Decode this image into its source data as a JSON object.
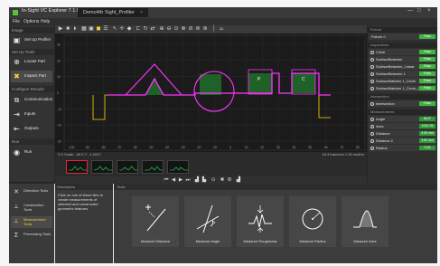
{
  "window": {
    "app_title": "In-Sight VC Explorer 7.1.0",
    "doc_tab": "Demo4th Sight_Profiler",
    "close_tab": "×",
    "controls": [
      "—",
      "□",
      "×"
    ]
  },
  "menu": [
    "File",
    "Options",
    "Help"
  ],
  "left_panel": {
    "sections": [
      {
        "title": "Image",
        "buttons": [
          {
            "label": "Set Up Profiler",
            "icon": "camera-icon"
          }
        ]
      },
      {
        "title": "Set Up Tools",
        "buttons": [
          {
            "label": "Locate Part",
            "icon": "target-icon"
          },
          {
            "label": "Inspect Part",
            "icon": "tools-icon",
            "active": true
          }
        ]
      },
      {
        "title": "Configure Results",
        "buttons": [
          {
            "label": "Communication",
            "icon": "network-icon"
          },
          {
            "label": "Inputs",
            "icon": "input-icon"
          },
          {
            "label": "Outputs",
            "icon": "output-icon"
          }
        ]
      },
      {
        "title": "Run",
        "buttons": [
          {
            "label": "Run",
            "icon": "play-icon"
          }
        ]
      }
    ]
  },
  "status_bar": {
    "left": "X:2 Scale: -90.0   Y: -1.0017",
    "right": "18.3 frames/s   1.29 ms/frm"
  },
  "plot": {
    "x_ticks": [
      "-100",
      "-90",
      "-80",
      "-70",
      "-60",
      "-50",
      "-40",
      "-30",
      "-20",
      "-10",
      "0",
      "10",
      "20",
      "30",
      "40",
      "50",
      "60",
      "70",
      "80"
    ],
    "y_ticks": [
      "30",
      "20",
      "10",
      "0",
      "-10",
      "-20",
      "-30"
    ],
    "region_labels": [
      "P",
      "C"
    ],
    "profile_color": "#ff33ff",
    "circle_color": "#ff33ff",
    "fill_color": "#1f6e2a",
    "baseline_color": "#ffd700"
  },
  "right_panel": {
    "groups": [
      {
        "title": "Fixture",
        "rows": [
          {
            "name": "Fixture 0",
            "status": "Pass"
          }
        ]
      },
      {
        "title": "Inspections",
        "rows": [
          {
            "name": "Circle",
            "status": "Pass"
          },
          {
            "name": "SurfaceBetween",
            "status": "Pass"
          },
          {
            "name": "SurfaceBetween_Linear",
            "status": "Pass"
          },
          {
            "name": "SurfaceBetween 1",
            "status": "Pass"
          },
          {
            "name": "SurfaceMatcher 1_Circle",
            "status": "Pass"
          },
          {
            "name": "SurfaceMatcher 1_Circle_Orient",
            "status": "Pass"
          }
        ]
      },
      {
        "title": "Intersection",
        "rows": [
          {
            "name": "Intersection",
            "status": "Pass"
          }
        ]
      },
      {
        "title": "Measurements",
        "rows": [
          {
            "name": "Angle",
            "status": "80.0°"
          },
          {
            "name": "Area",
            "status": "1012.78"
          },
          {
            "name": "Distance",
            "status": "4.90 mm"
          },
          {
            "name": "Distance 2",
            "status": "3.60 mm"
          },
          {
            "name": "Radius",
            "status": "0.45"
          }
        ]
      }
    ]
  },
  "bottom": {
    "tool_categories": [
      {
        "label": "Detection Tools",
        "icon": "detect-icon"
      },
      {
        "label": "Construction Tools",
        "icon": "construct-icon"
      },
      {
        "label": "Measurement Tools",
        "icon": "measure-icon",
        "active": true
      },
      {
        "label": "Processing Tools",
        "icon": "process-icon"
      }
    ],
    "description_title": "Description",
    "description_text": "Click on one of these tiles to create measurements of selected and constructed geometric features.",
    "tools_title": "Tools",
    "tiles": [
      {
        "label": "Measure Distance",
        "icon": "distance-icon"
      },
      {
        "label": "Measure Angle",
        "icon": "angle-icon"
      },
      {
        "label": "Measure Roughness",
        "icon": "roughness-icon"
      },
      {
        "label": "Measure Radius",
        "icon": "radius-icon"
      },
      {
        "label": "Measure Area",
        "icon": "area-icon"
      }
    ]
  }
}
